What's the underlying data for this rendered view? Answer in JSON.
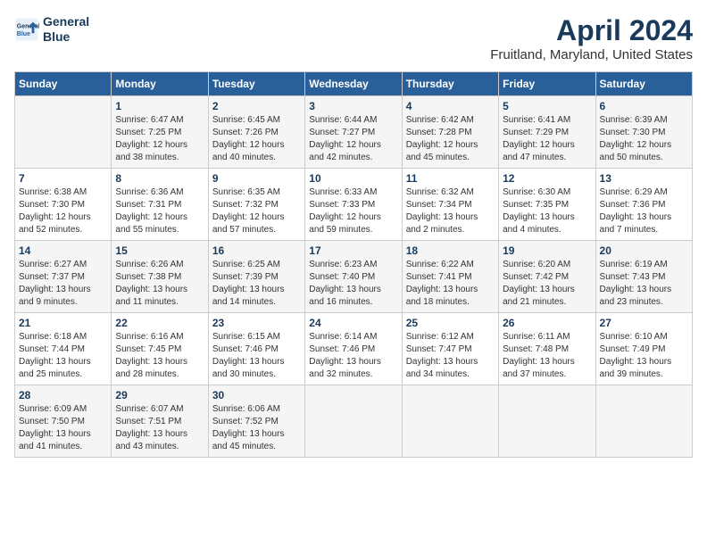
{
  "header": {
    "logo_line1": "General",
    "logo_line2": "Blue",
    "title": "April 2024",
    "subtitle": "Fruitland, Maryland, United States"
  },
  "days_of_week": [
    "Sunday",
    "Monday",
    "Tuesday",
    "Wednesday",
    "Thursday",
    "Friday",
    "Saturday"
  ],
  "weeks": [
    [
      {
        "day": "",
        "content": ""
      },
      {
        "day": "1",
        "content": "Sunrise: 6:47 AM\nSunset: 7:25 PM\nDaylight: 12 hours\nand 38 minutes."
      },
      {
        "day": "2",
        "content": "Sunrise: 6:45 AM\nSunset: 7:26 PM\nDaylight: 12 hours\nand 40 minutes."
      },
      {
        "day": "3",
        "content": "Sunrise: 6:44 AM\nSunset: 7:27 PM\nDaylight: 12 hours\nand 42 minutes."
      },
      {
        "day": "4",
        "content": "Sunrise: 6:42 AM\nSunset: 7:28 PM\nDaylight: 12 hours\nand 45 minutes."
      },
      {
        "day": "5",
        "content": "Sunrise: 6:41 AM\nSunset: 7:29 PM\nDaylight: 12 hours\nand 47 minutes."
      },
      {
        "day": "6",
        "content": "Sunrise: 6:39 AM\nSunset: 7:30 PM\nDaylight: 12 hours\nand 50 minutes."
      }
    ],
    [
      {
        "day": "7",
        "content": "Sunrise: 6:38 AM\nSunset: 7:30 PM\nDaylight: 12 hours\nand 52 minutes."
      },
      {
        "day": "8",
        "content": "Sunrise: 6:36 AM\nSunset: 7:31 PM\nDaylight: 12 hours\nand 55 minutes."
      },
      {
        "day": "9",
        "content": "Sunrise: 6:35 AM\nSunset: 7:32 PM\nDaylight: 12 hours\nand 57 minutes."
      },
      {
        "day": "10",
        "content": "Sunrise: 6:33 AM\nSunset: 7:33 PM\nDaylight: 12 hours\nand 59 minutes."
      },
      {
        "day": "11",
        "content": "Sunrise: 6:32 AM\nSunset: 7:34 PM\nDaylight: 13 hours\nand 2 minutes."
      },
      {
        "day": "12",
        "content": "Sunrise: 6:30 AM\nSunset: 7:35 PM\nDaylight: 13 hours\nand 4 minutes."
      },
      {
        "day": "13",
        "content": "Sunrise: 6:29 AM\nSunset: 7:36 PM\nDaylight: 13 hours\nand 7 minutes."
      }
    ],
    [
      {
        "day": "14",
        "content": "Sunrise: 6:27 AM\nSunset: 7:37 PM\nDaylight: 13 hours\nand 9 minutes."
      },
      {
        "day": "15",
        "content": "Sunrise: 6:26 AM\nSunset: 7:38 PM\nDaylight: 13 hours\nand 11 minutes."
      },
      {
        "day": "16",
        "content": "Sunrise: 6:25 AM\nSunset: 7:39 PM\nDaylight: 13 hours\nand 14 minutes."
      },
      {
        "day": "17",
        "content": "Sunrise: 6:23 AM\nSunset: 7:40 PM\nDaylight: 13 hours\nand 16 minutes."
      },
      {
        "day": "18",
        "content": "Sunrise: 6:22 AM\nSunset: 7:41 PM\nDaylight: 13 hours\nand 18 minutes."
      },
      {
        "day": "19",
        "content": "Sunrise: 6:20 AM\nSunset: 7:42 PM\nDaylight: 13 hours\nand 21 minutes."
      },
      {
        "day": "20",
        "content": "Sunrise: 6:19 AM\nSunset: 7:43 PM\nDaylight: 13 hours\nand 23 minutes."
      }
    ],
    [
      {
        "day": "21",
        "content": "Sunrise: 6:18 AM\nSunset: 7:44 PM\nDaylight: 13 hours\nand 25 minutes."
      },
      {
        "day": "22",
        "content": "Sunrise: 6:16 AM\nSunset: 7:45 PM\nDaylight: 13 hours\nand 28 minutes."
      },
      {
        "day": "23",
        "content": "Sunrise: 6:15 AM\nSunset: 7:46 PM\nDaylight: 13 hours\nand 30 minutes."
      },
      {
        "day": "24",
        "content": "Sunrise: 6:14 AM\nSunset: 7:46 PM\nDaylight: 13 hours\nand 32 minutes."
      },
      {
        "day": "25",
        "content": "Sunrise: 6:12 AM\nSunset: 7:47 PM\nDaylight: 13 hours\nand 34 minutes."
      },
      {
        "day": "26",
        "content": "Sunrise: 6:11 AM\nSunset: 7:48 PM\nDaylight: 13 hours\nand 37 minutes."
      },
      {
        "day": "27",
        "content": "Sunrise: 6:10 AM\nSunset: 7:49 PM\nDaylight: 13 hours\nand 39 minutes."
      }
    ],
    [
      {
        "day": "28",
        "content": "Sunrise: 6:09 AM\nSunset: 7:50 PM\nDaylight: 13 hours\nand 41 minutes."
      },
      {
        "day": "29",
        "content": "Sunrise: 6:07 AM\nSunset: 7:51 PM\nDaylight: 13 hours\nand 43 minutes."
      },
      {
        "day": "30",
        "content": "Sunrise: 6:06 AM\nSunset: 7:52 PM\nDaylight: 13 hours\nand 45 minutes."
      },
      {
        "day": "",
        "content": ""
      },
      {
        "day": "",
        "content": ""
      },
      {
        "day": "",
        "content": ""
      },
      {
        "day": "",
        "content": ""
      }
    ]
  ]
}
